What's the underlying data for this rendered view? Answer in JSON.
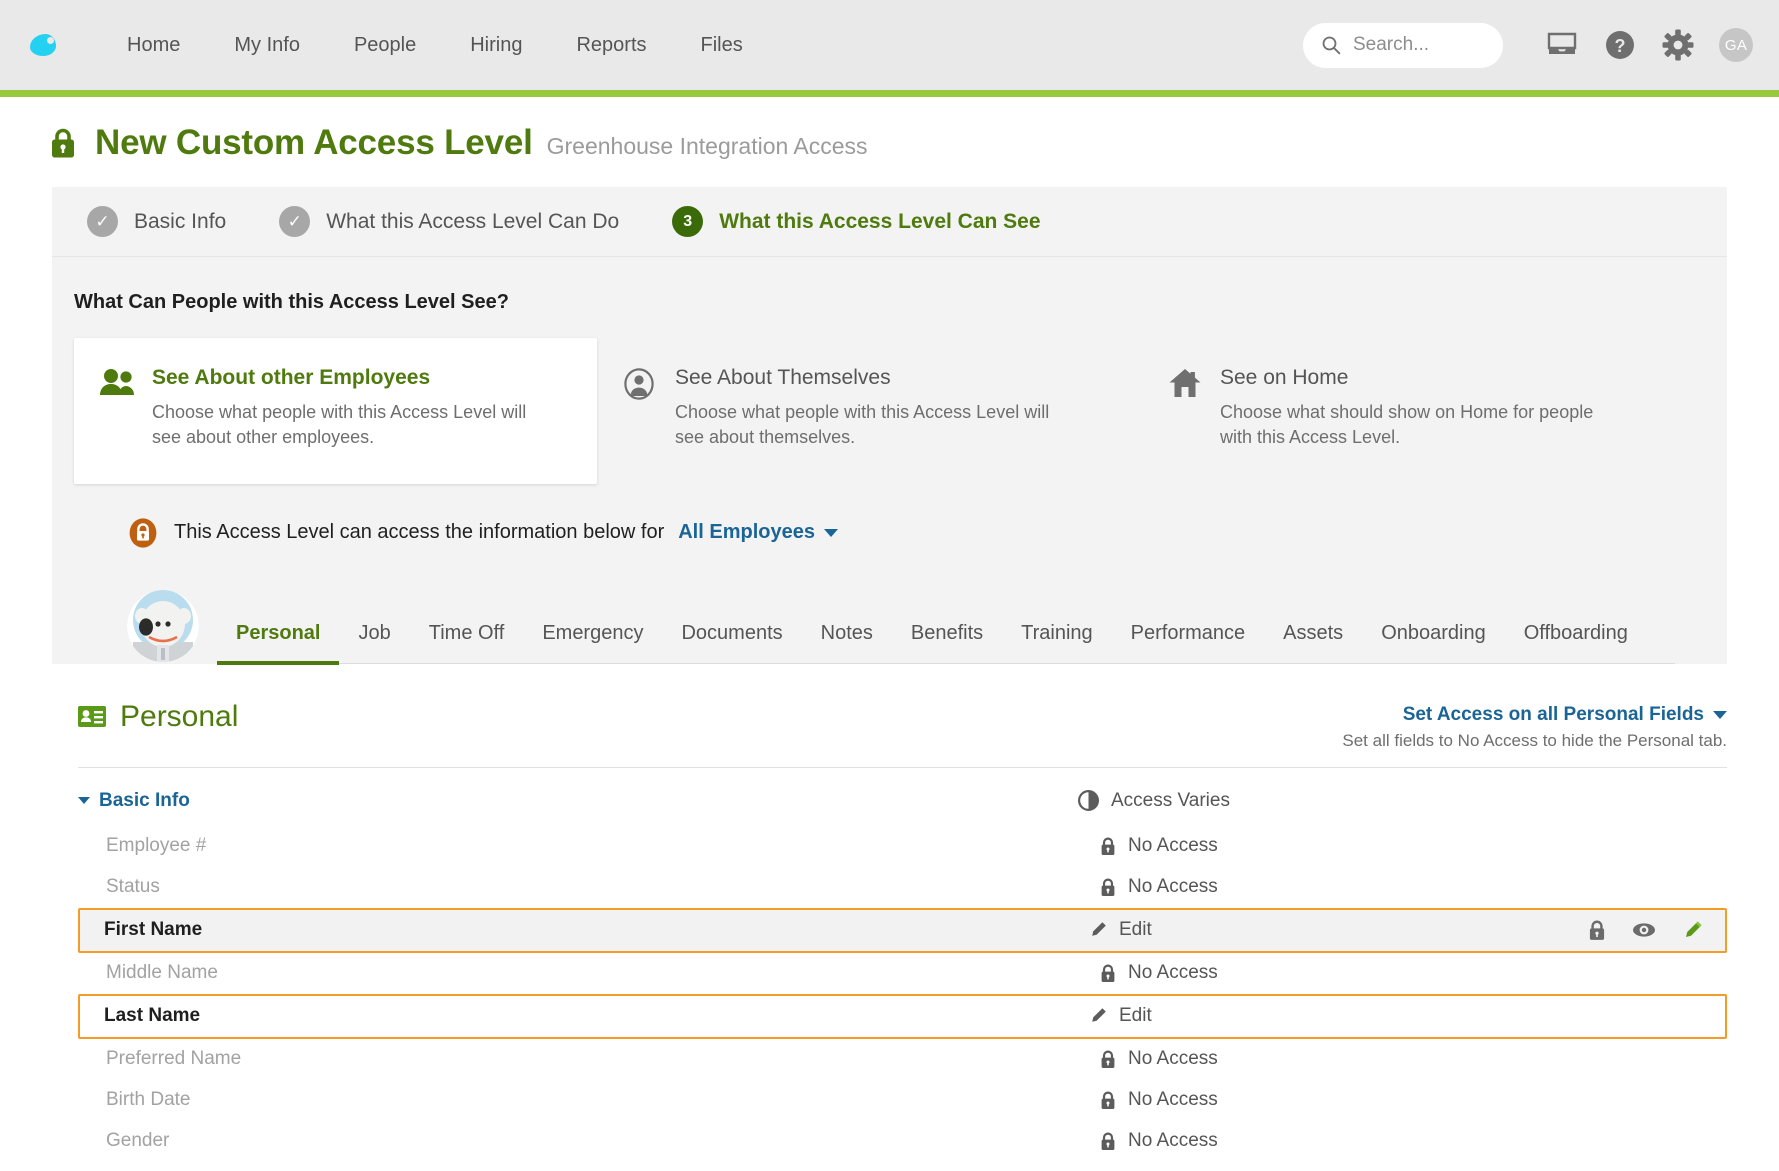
{
  "header": {
    "logo_icon": "bamboohr-leaf-icon",
    "nav": [
      {
        "label": "Home"
      },
      {
        "label": "My Info"
      },
      {
        "label": "People"
      },
      {
        "label": "Hiring"
      },
      {
        "label": "Reports"
      },
      {
        "label": "Files"
      }
    ],
    "search": {
      "placeholder": "Search...",
      "value": "",
      "icon": "search-icon"
    },
    "icons": [
      {
        "name": "inbox-icon"
      },
      {
        "name": "help-question-icon"
      },
      {
        "name": "gear-settings-icon"
      }
    ],
    "user_initials": "GA",
    "accent_bar_color": "#98c93c"
  },
  "page": {
    "lock_icon": "green-lock-icon",
    "title": "New Custom Access Level",
    "subtitle": "Greenhouse Integration Access",
    "title_color": "#4e7a0e"
  },
  "stepper": {
    "steps": [
      {
        "badge": "✓",
        "label": "Basic Info",
        "state": "complete"
      },
      {
        "badge": "✓",
        "label": "What this Access Level Can Do",
        "state": "complete"
      },
      {
        "badge": "3",
        "label": "What this Access Level Can See",
        "state": "current"
      }
    ],
    "current_color": "#3b6b09"
  },
  "panel": {
    "question": "What Can People with this Access Level See?",
    "cards": [
      {
        "icon": "two-people-icon",
        "title": "See About other Employees",
        "desc": "Choose what people with this Access Level will see about other employees.",
        "selected": true
      },
      {
        "icon": "person-circle-icon",
        "title": "See About Themselves",
        "desc": "Choose what people with this Access Level will see about themselves.",
        "selected": false
      },
      {
        "icon": "home-house-icon",
        "title": "See on Home",
        "desc": "Choose what should show on Home for people with this Access Level.",
        "selected": false
      }
    ]
  },
  "scope": {
    "lock_icon": "orange-lock-icon",
    "text": "This Access Level can access the information below for",
    "selected": "All Employees",
    "link_color": "#1a6496"
  },
  "employee_tabs": {
    "avatar_icon": "panda-employee-avatar",
    "tabs": [
      {
        "label": "Personal",
        "active": true
      },
      {
        "label": "Job",
        "active": false
      },
      {
        "label": "Time Off",
        "active": false
      },
      {
        "label": "Emergency",
        "active": false
      },
      {
        "label": "Documents",
        "active": false
      },
      {
        "label": "Notes",
        "active": false
      },
      {
        "label": "Benefits",
        "active": false
      },
      {
        "label": "Training",
        "active": false
      },
      {
        "label": "Performance",
        "active": false
      },
      {
        "label": "Assets",
        "active": false
      },
      {
        "label": "Onboarding",
        "active": false
      },
      {
        "label": "Offboarding",
        "active": false
      }
    ]
  },
  "section": {
    "icon": "id-card-icon",
    "title": "Personal",
    "set_access_label": "Set Access on all Personal Fields",
    "set_access_note": "Set all fields to No Access to hide the Personal tab."
  },
  "field_group": {
    "toggle_label": "Basic Info",
    "group_access_label": "Access Varies",
    "group_access_icon": "half-circle-icon",
    "fields": [
      {
        "label": "Employee #",
        "access": "No Access",
        "access_icon": "lock-icon",
        "highlight": false,
        "hovered": false
      },
      {
        "label": "Status",
        "access": "No Access",
        "access_icon": "lock-icon",
        "highlight": false,
        "hovered": false
      },
      {
        "label": "First Name",
        "access": "Edit",
        "access_icon": "pencil-icon",
        "highlight": true,
        "hovered": true
      },
      {
        "label": "Middle Name",
        "access": "No Access",
        "access_icon": "lock-icon",
        "highlight": false,
        "hovered": false
      },
      {
        "label": "Last Name",
        "access": "Edit",
        "access_icon": "pencil-icon",
        "highlight": true,
        "hovered": false
      },
      {
        "label": "Preferred Name",
        "access": "No Access",
        "access_icon": "lock-icon",
        "highlight": false,
        "hovered": false
      },
      {
        "label": "Birth Date",
        "access": "No Access",
        "access_icon": "lock-icon",
        "highlight": false,
        "hovered": false
      },
      {
        "label": "Gender",
        "access": "No Access",
        "access_icon": "lock-icon",
        "highlight": false,
        "hovered": false
      }
    ],
    "row_actions": [
      {
        "name": "no-access-lock-icon",
        "active": false
      },
      {
        "name": "view-eye-icon",
        "active": false
      },
      {
        "name": "edit-pencil-icon",
        "active": true
      }
    ],
    "highlight_color": "#f59b28",
    "active_action_color": "#5b9a16"
  }
}
